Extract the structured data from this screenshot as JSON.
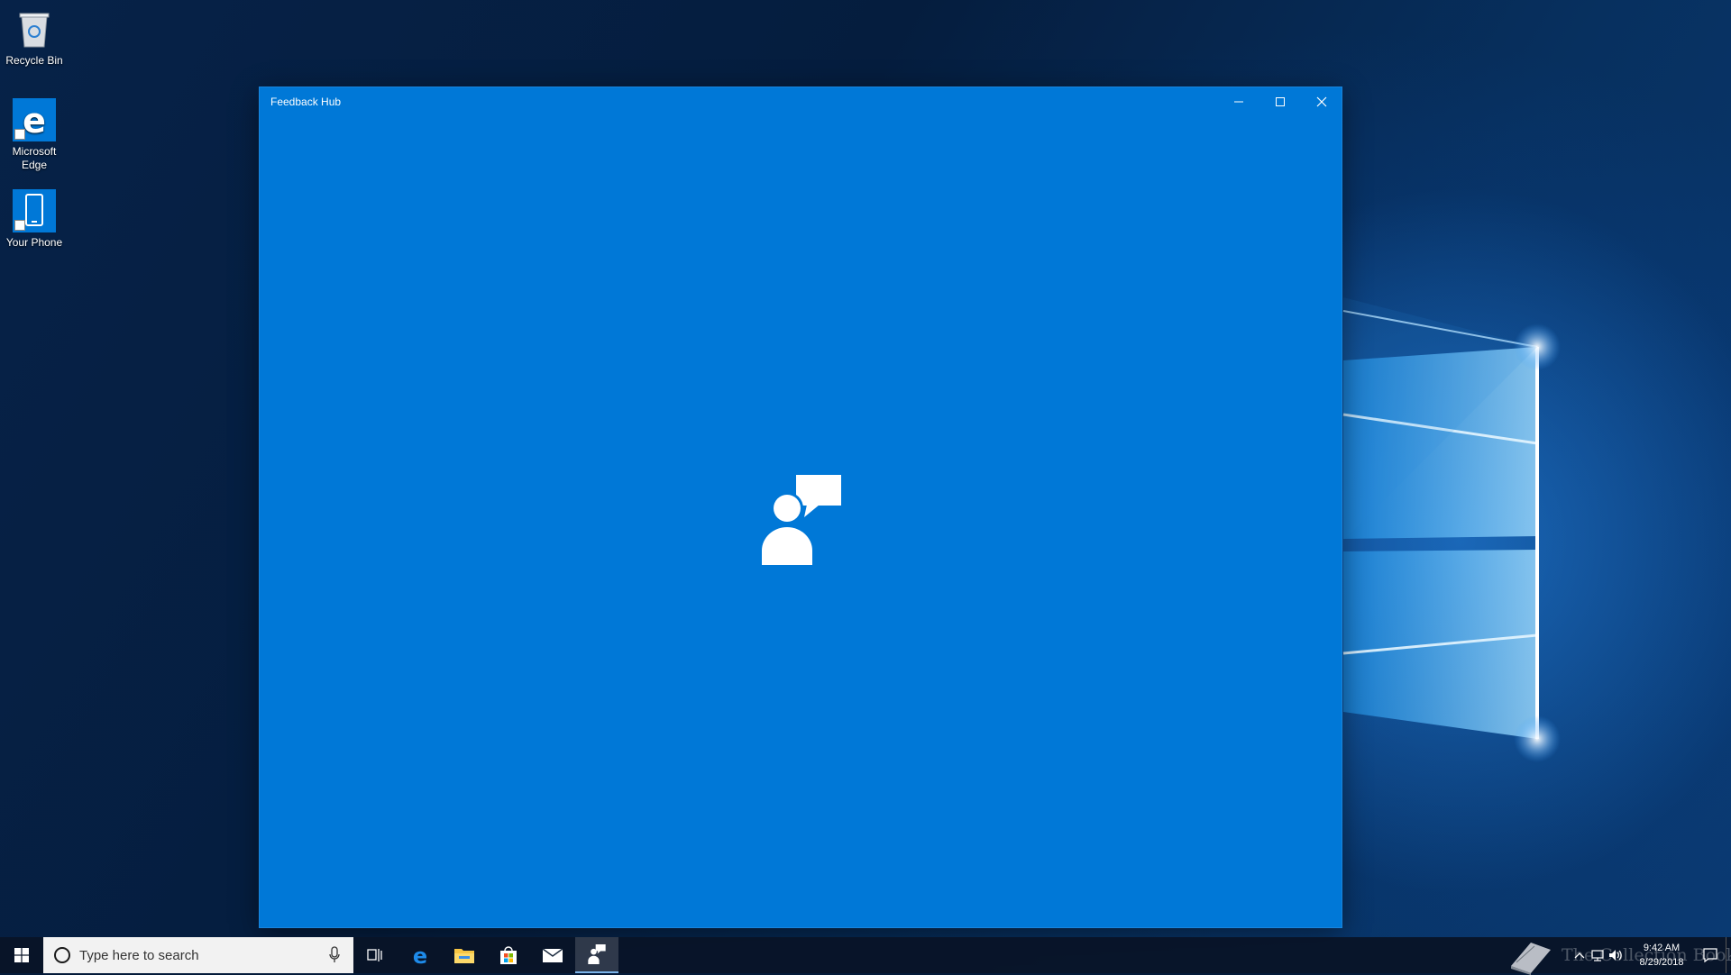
{
  "desktop": {
    "icons": [
      {
        "label": "Recycle Bin",
        "icon": "recycle-bin-icon"
      },
      {
        "label": "Microsoft Edge",
        "icon": "edge-icon"
      },
      {
        "label": "Your Phone",
        "icon": "phone-icon"
      }
    ]
  },
  "window": {
    "title": "Feedback Hub",
    "background": "#0078d7",
    "controls": {
      "minimize": "minimize-icon",
      "maximize": "maximize-icon",
      "close": "close-icon"
    },
    "splash_icon": "feedback-person-speech-icon"
  },
  "taskbar": {
    "search": {
      "placeholder": "Type here to search"
    },
    "pinned": [
      {
        "name": "Task View",
        "icon": "task-view-icon"
      },
      {
        "name": "Microsoft Edge",
        "icon": "edge-icon"
      },
      {
        "name": "File Explorer",
        "icon": "folder-icon"
      },
      {
        "name": "Microsoft Store",
        "icon": "store-bag-icon"
      },
      {
        "name": "Mail",
        "icon": "mail-icon"
      },
      {
        "name": "Feedback Hub",
        "icon": "feedback-icon",
        "active": true
      }
    ],
    "watermark": "The Collection Book",
    "clock": {
      "time": "9:42 AM",
      "date": "8/29/2018"
    }
  }
}
